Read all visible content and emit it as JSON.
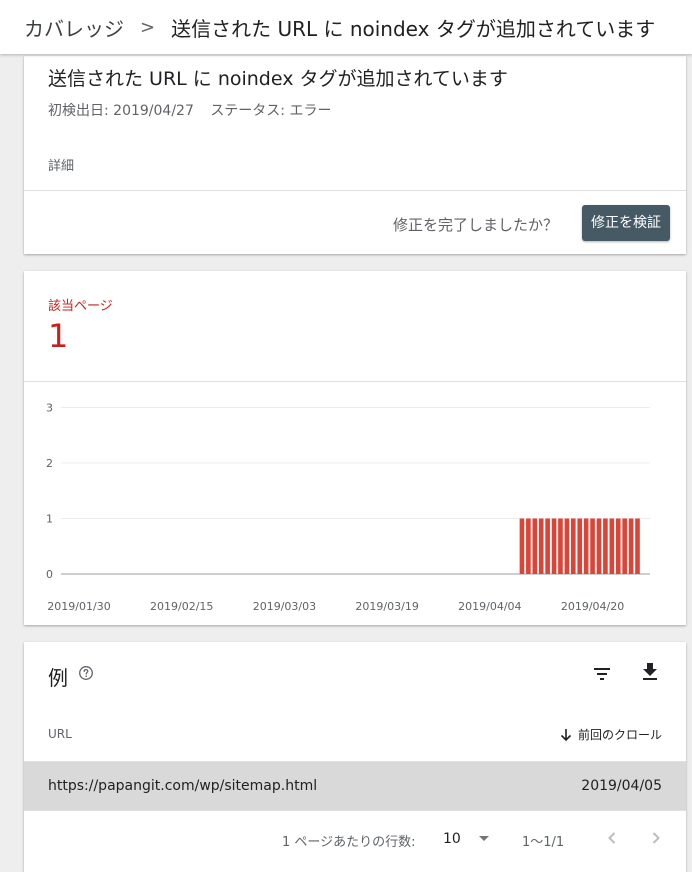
{
  "breadcrumb": {
    "root": "カバレッジ",
    "separator": ">",
    "current": "送信された URL に noindex タグが追加されています"
  },
  "issue": {
    "title": "送信された URL に noindex タグが追加されています",
    "first_detected": "初検出日: 2019/04/27",
    "status": "ステータス: エラー",
    "details_label": "詳細",
    "question": "修正を完了しましたか？",
    "validate_button": "修正を検証"
  },
  "affected": {
    "label": "該当ページ",
    "count": "1"
  },
  "chart_data": {
    "type": "bar",
    "title": "",
    "xlabel": "",
    "ylabel": "",
    "ylim": [
      0,
      3
    ],
    "yticks": [
      "0",
      "1",
      "2",
      "3"
    ],
    "xticks": [
      "2019/01/30",
      "2019/02/15",
      "2019/03/03",
      "2019/03/19",
      "2019/04/04",
      "2019/04/20"
    ],
    "x": [
      "2019/04/09",
      "2019/04/10",
      "2019/04/11",
      "2019/04/12",
      "2019/04/13",
      "2019/04/14",
      "2019/04/15",
      "2019/04/16",
      "2019/04/17",
      "2019/04/18",
      "2019/04/19",
      "2019/04/20",
      "2019/04/21",
      "2019/04/22",
      "2019/04/23",
      "2019/04/24",
      "2019/04/25",
      "2019/04/26",
      "2019/04/27"
    ],
    "values": [
      1,
      1,
      1,
      1,
      1,
      1,
      1,
      1,
      1,
      1,
      1,
      1,
      1,
      1,
      1,
      1,
      1,
      1,
      1
    ],
    "x_range": [
      "2019/01/30",
      "2019/04/27"
    ],
    "bar_color": "#db4437",
    "grid": true
  },
  "examples": {
    "title": "例",
    "help_icon": "help-circle-icon",
    "filter_icon": "filter-icon",
    "download_icon": "download-icon",
    "columns": {
      "url": "URL",
      "last_crawl": "前回のクロール"
    },
    "rows": [
      {
        "url": "https://papangit.com/wp/sitemap.html",
        "date": "2019/04/05"
      }
    ],
    "pagination": {
      "rows_per_page_label": "1 ページあたりの行数:",
      "rows_per_page": "10",
      "range": "1〜1/1"
    }
  },
  "colors": {
    "error_red": "#c5221f",
    "bar_red": "#db4437",
    "button_bg": "#455a64",
    "row_highlight": "#d9d9d9"
  }
}
